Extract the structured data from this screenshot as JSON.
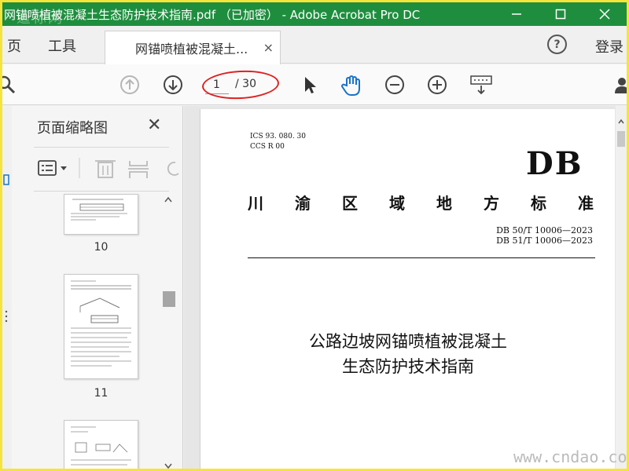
{
  "window": {
    "title": "网锚喷植被混凝土生态防护技术指南.pdf （已加密） - Adobe Acrobat Pro DC",
    "watermark": "道标网",
    "accent": "#1e8e3e"
  },
  "tabs": {
    "home_label": "页",
    "tools_label": "工具",
    "doc_tab_label": "网锚喷植被混凝土...",
    "close_glyph": "×",
    "help_glyph": "?",
    "login_label": "登录"
  },
  "toolbar": {
    "current_page": "1",
    "total_pages": "/ 30",
    "icons": [
      "search-icon",
      "prev-page-icon",
      "next-page-icon",
      "select-arrow-icon",
      "hand-tool-icon",
      "zoom-out-icon",
      "zoom-in-icon",
      "keyboard-icon",
      "user-icon"
    ]
  },
  "thumbnail_panel": {
    "title": "页面缩略图",
    "close_glyph": "✕",
    "pages": [
      {
        "label": "10"
      },
      {
        "label": "11"
      }
    ]
  },
  "document": {
    "ics_line1": "ICS 93. 080. 30",
    "ics_line2": "CCS R 00",
    "db_mark": "DB",
    "standard_chars": [
      "川",
      "渝",
      "区",
      "域",
      "地",
      "方",
      "标",
      "准"
    ],
    "std_num_line1": "DB  50/T  10006—2023",
    "std_num_line2": "DB  51/T  10006—2023",
    "heading_line1": "公路边坡网锚喷植被混凝土",
    "heading_line2": "生态防护技术指南"
  },
  "site_watermark": "www.cndao.com"
}
